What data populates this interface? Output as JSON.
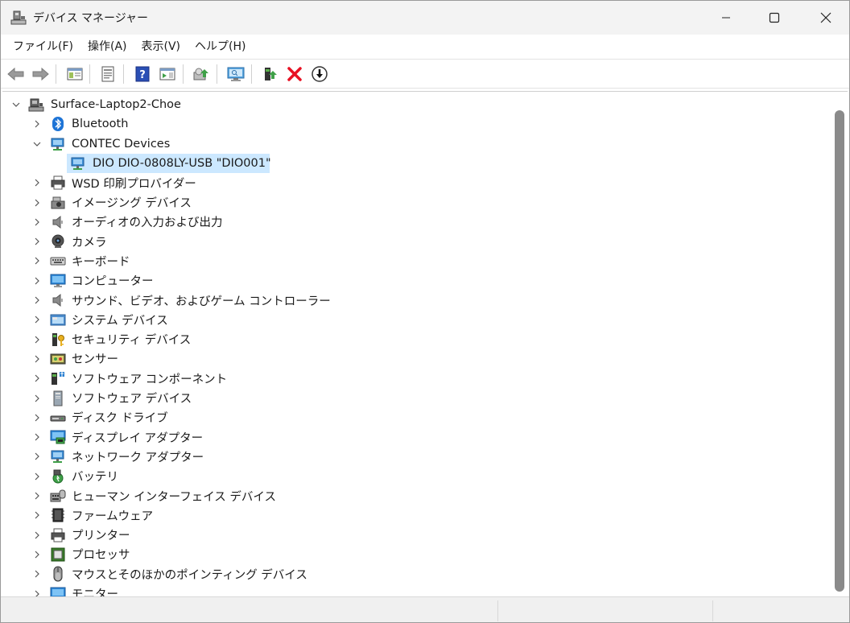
{
  "window": {
    "title": "デバイス マネージャー",
    "controls": {
      "minimize": "minimize",
      "maximize": "maximize",
      "close": "close"
    }
  },
  "menu": [
    {
      "label": "ファイル(F)"
    },
    {
      "label": "操作(A)"
    },
    {
      "label": "表示(V)"
    },
    {
      "label": "ヘルプ(H)"
    }
  ],
  "toolbar": [
    {
      "icon": "back-arrow-icon"
    },
    {
      "icon": "forward-arrow-icon"
    },
    {
      "icon": "show-hide-console-tree-icon"
    },
    {
      "icon": "properties-icon"
    },
    {
      "icon": "help-icon"
    },
    {
      "icon": "action-pane-icon"
    },
    {
      "icon": "update-driver-icon"
    },
    {
      "icon": "scan-hardware-icon"
    },
    {
      "icon": "add-legacy-hardware-icon"
    },
    {
      "icon": "uninstall-device-icon"
    },
    {
      "icon": "disable-device-icon"
    }
  ],
  "tree": {
    "root": {
      "label": "Surface-Laptop2-Choe",
      "expanded": true
    },
    "items": [
      {
        "label": "Bluetooth",
        "icon": "bluetooth-icon",
        "expanded": false,
        "level": 1
      },
      {
        "label": "CONTEC Devices",
        "icon": "network-device-icon",
        "expanded": true,
        "level": 1
      },
      {
        "label": "DIO DIO-0808LY-USB \"DIO001\"",
        "icon": "network-device-icon",
        "level": 2,
        "selected": true
      },
      {
        "label": "WSD 印刷プロバイダー",
        "icon": "printer-icon",
        "expanded": false,
        "level": 1
      },
      {
        "label": "イメージング デバイス",
        "icon": "imaging-icon",
        "expanded": false,
        "level": 1
      },
      {
        "label": "オーディオの入力および出力",
        "icon": "speaker-icon",
        "expanded": false,
        "level": 1
      },
      {
        "label": "カメラ",
        "icon": "camera-icon",
        "expanded": false,
        "level": 1
      },
      {
        "label": "キーボード",
        "icon": "keyboard-icon",
        "expanded": false,
        "level": 1
      },
      {
        "label": "コンピューター",
        "icon": "monitor-icon",
        "expanded": false,
        "level": 1
      },
      {
        "label": "サウンド、ビデオ、およびゲーム コントローラー",
        "icon": "speaker-icon",
        "expanded": false,
        "level": 1
      },
      {
        "label": "システム デバイス",
        "icon": "system-folder-icon",
        "expanded": false,
        "level": 1
      },
      {
        "label": "セキュリティ デバイス",
        "icon": "security-key-icon",
        "expanded": false,
        "level": 1
      },
      {
        "label": "センサー",
        "icon": "sensor-icon",
        "expanded": false,
        "level": 1
      },
      {
        "label": "ソフトウェア コンポーネント",
        "icon": "software-component-icon",
        "expanded": false,
        "level": 1
      },
      {
        "label": "ソフトウェア デバイス",
        "icon": "software-device-icon",
        "expanded": false,
        "level": 1
      },
      {
        "label": "ディスク ドライブ",
        "icon": "disk-drive-icon",
        "expanded": false,
        "level": 1
      },
      {
        "label": "ディスプレイ アダプター",
        "icon": "display-adapter-icon",
        "expanded": false,
        "level": 1
      },
      {
        "label": "ネットワーク アダプター",
        "icon": "network-device-icon",
        "expanded": false,
        "level": 1
      },
      {
        "label": "バッテリ",
        "icon": "battery-icon",
        "expanded": false,
        "level": 1
      },
      {
        "label": "ヒューマン インターフェイス デバイス",
        "icon": "hid-icon",
        "expanded": false,
        "level": 1
      },
      {
        "label": "ファームウェア",
        "icon": "firmware-icon",
        "expanded": false,
        "level": 1
      },
      {
        "label": "プリンター",
        "icon": "printer-icon",
        "expanded": false,
        "level": 1
      },
      {
        "label": "プロセッサ",
        "icon": "processor-icon",
        "expanded": false,
        "level": 1
      },
      {
        "label": "マウスとそのほかのポインティング デバイス",
        "icon": "mouse-icon",
        "expanded": false,
        "level": 1
      },
      {
        "label": "モニター",
        "icon": "monitor-icon",
        "expanded": false,
        "level": 1
      }
    ]
  },
  "colors": {
    "selection": "#cce8ff",
    "titlebar": "#f3f3f3",
    "scroll_thumb": "#8a8a8a",
    "uninstall_red": "#e81123"
  }
}
